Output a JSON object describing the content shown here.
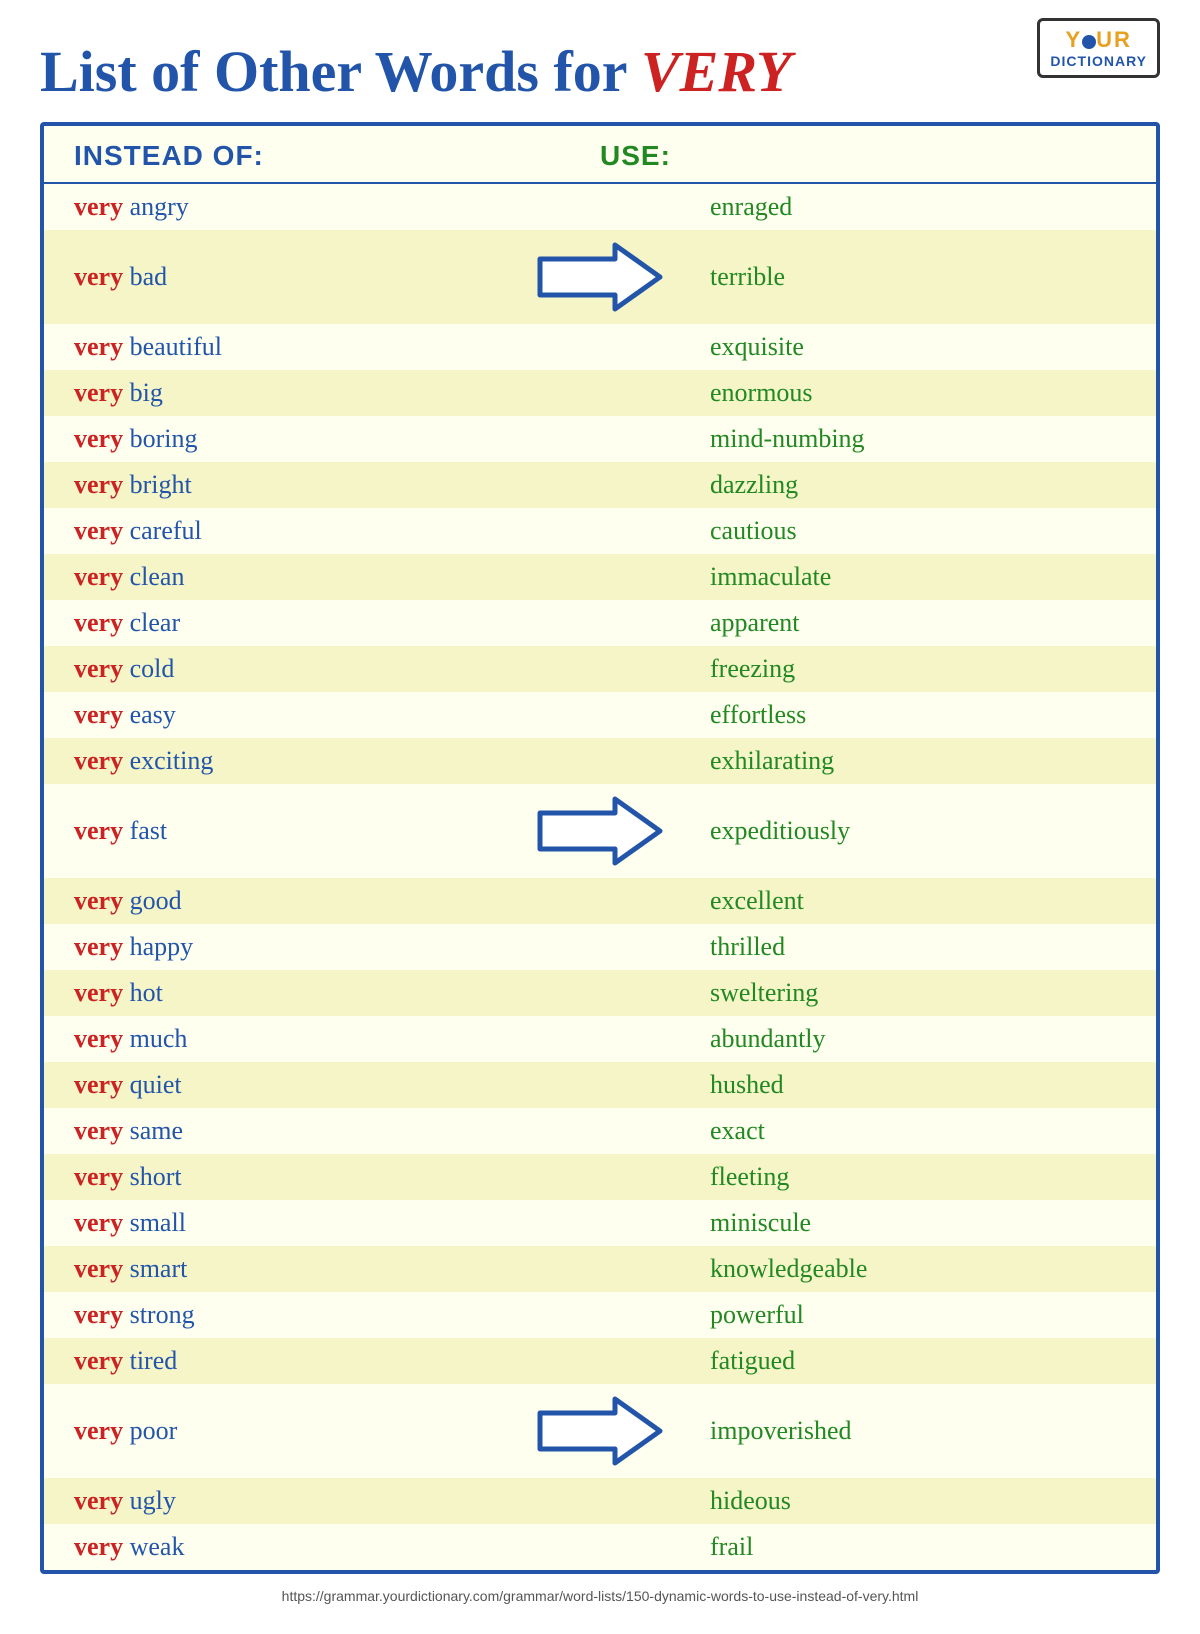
{
  "logo": {
    "your": "YOUR",
    "dictionary": "DICTIONARY"
  },
  "title": {
    "text": "List of Other Words for ",
    "highlight": "VERY"
  },
  "header": {
    "instead": "INSTEAD OF:",
    "use": "USE:"
  },
  "rows": [
    {
      "very": "very",
      "word": "angry",
      "use": "enraged",
      "arrow": false
    },
    {
      "very": "very",
      "word": "bad",
      "use": "terrible",
      "arrow": true
    },
    {
      "very": "very",
      "word": "beautiful",
      "use": "exquisite",
      "arrow": false
    },
    {
      "very": "very",
      "word": "big",
      "use": "enormous",
      "arrow": false
    },
    {
      "very": "very",
      "word": "boring",
      "use": "mind-numbing",
      "arrow": false
    },
    {
      "very": "very",
      "word": "bright",
      "use": "dazzling",
      "arrow": false
    },
    {
      "very": "very",
      "word": "careful",
      "use": "cautious",
      "arrow": false
    },
    {
      "very": "very",
      "word": "clean",
      "use": "immaculate",
      "arrow": false
    },
    {
      "very": "very",
      "word": "clear",
      "use": "apparent",
      "arrow": false
    },
    {
      "very": "very",
      "word": "cold",
      "use": "freezing",
      "arrow": false
    },
    {
      "very": "very",
      "word": "easy",
      "use": "effortless",
      "arrow": false
    },
    {
      "very": "very",
      "word": "exciting",
      "use": "exhilarating",
      "arrow": false
    },
    {
      "very": "very",
      "word": "fast",
      "use": "expeditiously",
      "arrow": true
    },
    {
      "very": "very",
      "word": "good",
      "use": "excellent",
      "arrow": false
    },
    {
      "very": "very",
      "word": "happy",
      "use": "thrilled",
      "arrow": false
    },
    {
      "very": "very",
      "word": "hot",
      "use": "sweltering",
      "arrow": false
    },
    {
      "very": "very",
      "word": "much",
      "use": "abundantly",
      "arrow": false
    },
    {
      "very": "very",
      "word": "quiet",
      "use": "hushed",
      "arrow": false
    },
    {
      "very": "very",
      "word": "same",
      "use": "exact",
      "arrow": false
    },
    {
      "very": "very",
      "word": "short",
      "use": "fleeting",
      "arrow": false
    },
    {
      "very": "very",
      "word": "small",
      "use": "miniscule",
      "arrow": false
    },
    {
      "very": "very",
      "word": "smart",
      "use": "knowledgeable",
      "arrow": false
    },
    {
      "very": "very",
      "word": "strong",
      "use": "powerful",
      "arrow": false
    },
    {
      "very": "very",
      "word": "tired",
      "use": "fatigued",
      "arrow": false
    },
    {
      "very": "very",
      "word": "poor",
      "use": "impoverished",
      "arrow": true
    },
    {
      "very": "very",
      "word": "ugly",
      "use": "hideous",
      "arrow": false
    },
    {
      "very": "very",
      "word": "weak",
      "use": "frail",
      "arrow": false
    }
  ],
  "footer_url": "https://grammar.yourdictionary.com/grammar/word-lists/150-dynamic-words-to-use-instead-of-very.html"
}
